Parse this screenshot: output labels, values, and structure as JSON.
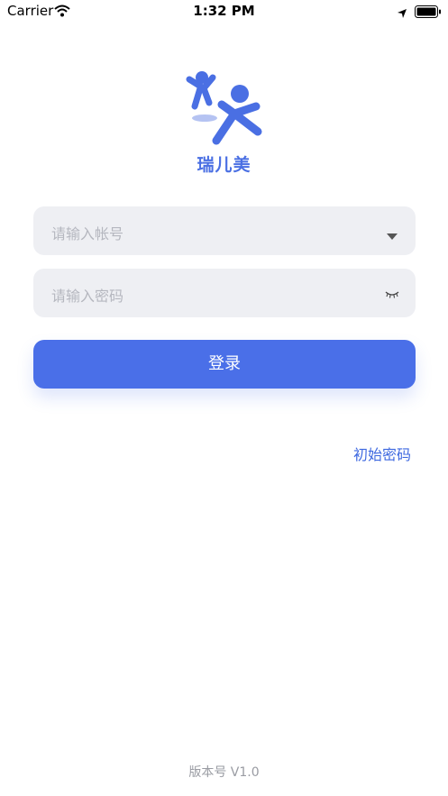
{
  "status_bar": {
    "carrier": "Carrier",
    "time": "1:32 PM",
    "icons": [
      "wifi-icon",
      "location-icon",
      "battery-icon"
    ]
  },
  "logo": {
    "brand_name": "瑞儿美",
    "accent_color": "#4a6fe3"
  },
  "form": {
    "account_placeholder": "请输入帐号",
    "password_placeholder": "请输入密码",
    "account_dropdown_icon": "caret-down-icon",
    "password_toggle_icon": "eye-closed-icon",
    "login_label": "登录",
    "login_color": "#4a6fe8"
  },
  "links": {
    "initial_password": "初始密码"
  },
  "footer": {
    "version": "版本号 V1.0"
  }
}
